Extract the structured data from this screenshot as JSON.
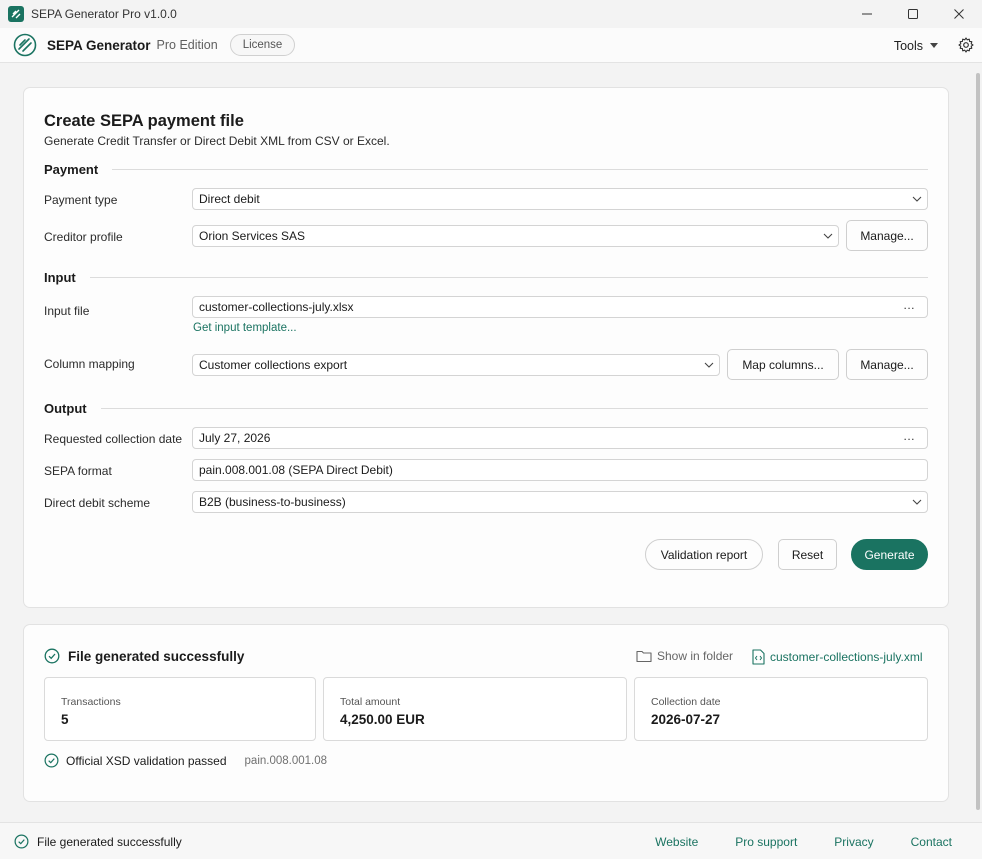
{
  "window": {
    "title": "SEPA Generator Pro v1.0.0",
    "minimize_icon": "minimize-icon",
    "maximize_icon": "maximize-icon",
    "close_icon": "close-icon"
  },
  "appbar": {
    "brand": "SEPA Generator",
    "edition": "Pro Edition",
    "license_label": "License",
    "tools_label": "Tools",
    "settings_icon": "gear-icon"
  },
  "form": {
    "title": "Create SEPA payment file",
    "subtitle": "Generate Credit Transfer or Direct Debit XML from CSV or Excel.",
    "payment_section": "Payment",
    "payment_type_label": "Payment type",
    "payment_type_value": "Direct debit",
    "creditor_profile_label": "Creditor profile",
    "creditor_profile_value": "Orion Services SAS",
    "manage_label": "Manage...",
    "input_section": "Input",
    "input_file_label": "Input file",
    "input_file_value": "customer-collections-july.xlsx",
    "browse_label": "...",
    "template_link": "Get input template...",
    "column_mapping_label": "Column mapping",
    "column_mapping_value": "Customer collections export",
    "map_columns_label": "Map columns...",
    "output_section": "Output",
    "collection_date_label": "Requested collection date",
    "collection_date_value": "July 27, 2026",
    "sepa_format_label": "SEPA format",
    "sepa_format_value": "pain.008.001.08 (SEPA Direct Debit)",
    "scheme_label": "Direct debit scheme",
    "scheme_value": "B2B (business-to-business)",
    "validation_report_label": "Validation report",
    "reset_label": "Reset",
    "generate_label": "Generate"
  },
  "result": {
    "title": "File generated successfully",
    "show_in_folder": "Show in folder",
    "file_name": "customer-collections-july.xml",
    "stats": [
      {
        "label": "Transactions",
        "value": "5"
      },
      {
        "label": "Total amount",
        "value": "4,250.00 EUR"
      },
      {
        "label": "Collection date",
        "value": "2026-07-27"
      }
    ],
    "xsd_status": "Official XSD validation passed",
    "xsd_format": "pain.008.001.08"
  },
  "statusbar": {
    "message": "File generated successfully",
    "links": [
      "Website",
      "Pro support",
      "Privacy",
      "Contact"
    ]
  },
  "colors": {
    "accent": "#1a7361",
    "background": "#f3f3f3",
    "card": "#fdfdfd"
  }
}
